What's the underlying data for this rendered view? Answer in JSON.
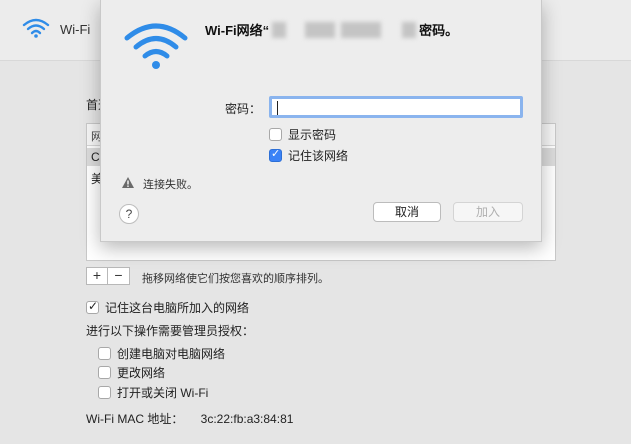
{
  "window": {
    "title": "Wi-Fi",
    "wifi_icon": "wifi-icon"
  },
  "preferences": {
    "networks_label": "首选",
    "list_header": "网",
    "rows": [
      "Ch",
      "美"
    ],
    "add_button": "+",
    "remove_button": "−",
    "drag_hint": "拖移网络使它们按您喜欢的顺序排列。",
    "remember_networks_label": "记住这台电脑所加入的网络",
    "admin_heading": "进行以下操作需要管理员授权：",
    "admin_options": [
      "创建电脑对电脑网络",
      "更改网络",
      "打开或关闭 Wi-Fi"
    ],
    "mac_label": "Wi-Fi MAC 地址：",
    "mac_value": "3c:22:fb:a3:84:81"
  },
  "dialog": {
    "title_prefix": "Wi-Fi网络“",
    "title_suffix": "密码。",
    "password_label": "密码：",
    "password_value": "",
    "show_password_label": "显示密码",
    "remember_network_label": "记住该网络",
    "error_text": "连接失败。",
    "help_label": "?",
    "cancel_label": "取消",
    "add_label": "加入",
    "accent_color": "#3b82f6"
  }
}
